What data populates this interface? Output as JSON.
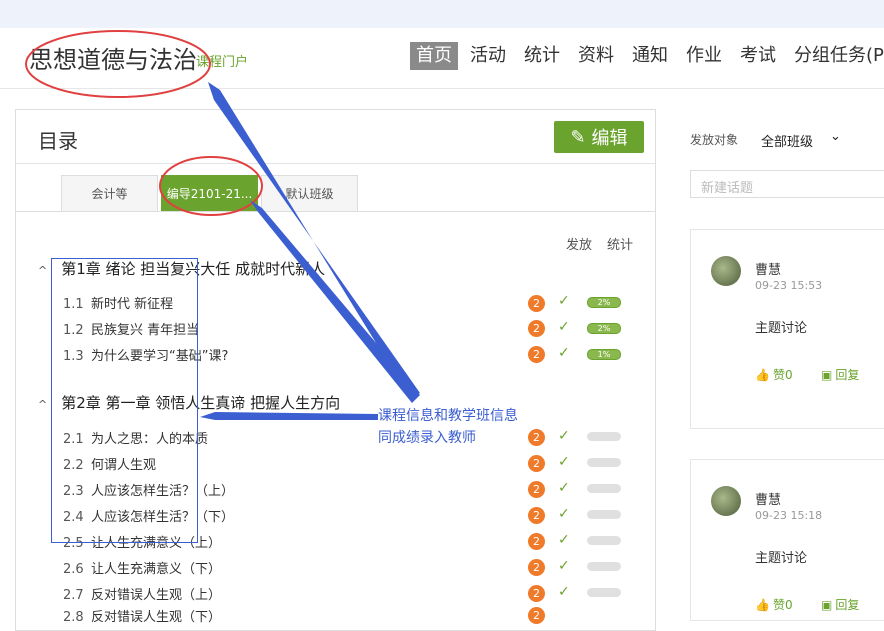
{
  "header": {
    "course_title": "思想道德与法治",
    "portal_link": "课程门户",
    "nav": [
      "首页",
      "活动",
      "统计",
      "资料",
      "通知",
      "作业",
      "考试",
      "分组任务(PB"
    ]
  },
  "catalog": {
    "title": "目录",
    "edit_label": "编辑",
    "tabs": [
      "会计等",
      "编导2101-21...",
      "默认班级"
    ],
    "col_publish": "发放",
    "col_stats": "统计",
    "chapter1": {
      "title": "第1章 绪论 担当复兴大任 成就时代新人",
      "lessons": [
        {
          "num": "1.1",
          "title": "新时代 新征程",
          "badge": "2",
          "stat": "2%"
        },
        {
          "num": "1.2",
          "title": "民族复兴 青年担当",
          "badge": "2",
          "stat": "2%"
        },
        {
          "num": "1.3",
          "title": "为什么要学习“基础”课?",
          "badge": "2",
          "stat": "1%"
        }
      ]
    },
    "chapter2": {
      "title": "第2章 第一章 领悟人生真谛 把握人生方向",
      "lessons": [
        {
          "num": "2.1",
          "title": "为人之思：人的本质",
          "badge": "2"
        },
        {
          "num": "2.2",
          "title": "何谓人生观",
          "badge": "2"
        },
        {
          "num": "2.3",
          "title": "人应该怎样生活？（上）",
          "badge": "2"
        },
        {
          "num": "2.4",
          "title": "人应该怎样生活？（下）",
          "badge": "2"
        },
        {
          "num": "2.5",
          "title": "让人生充满意义（上）",
          "badge": "2"
        },
        {
          "num": "2.6",
          "title": "让人生充满意义（下）",
          "badge": "2"
        },
        {
          "num": "2.7",
          "title": "反对错误人生观（上）",
          "badge": "2"
        },
        {
          "num": "2.8",
          "title": "反对错误人生观（下）",
          "badge": "2"
        }
      ]
    }
  },
  "sidebar": {
    "target_label": "发放对象",
    "target_value": "全部班级",
    "new_topic_placeholder": "新建话题",
    "posts": [
      {
        "author": "曹慧",
        "time": "09-23 15:53",
        "content": "主题讨论",
        "likes": "赞0",
        "reply": "回复"
      },
      {
        "author": "曹慧",
        "time": "09-23 15:18",
        "content": "主题讨论",
        "likes": "赞0",
        "reply": "回复"
      }
    ]
  },
  "annotation": {
    "line1": "课程信息和教学班信息",
    "line2": "同成绩录入教师"
  },
  "colors": {
    "accent": "#6aa32d",
    "badge": "#ef7a2a",
    "annotation": "#3b5ed0",
    "highlight": "#e04040"
  }
}
